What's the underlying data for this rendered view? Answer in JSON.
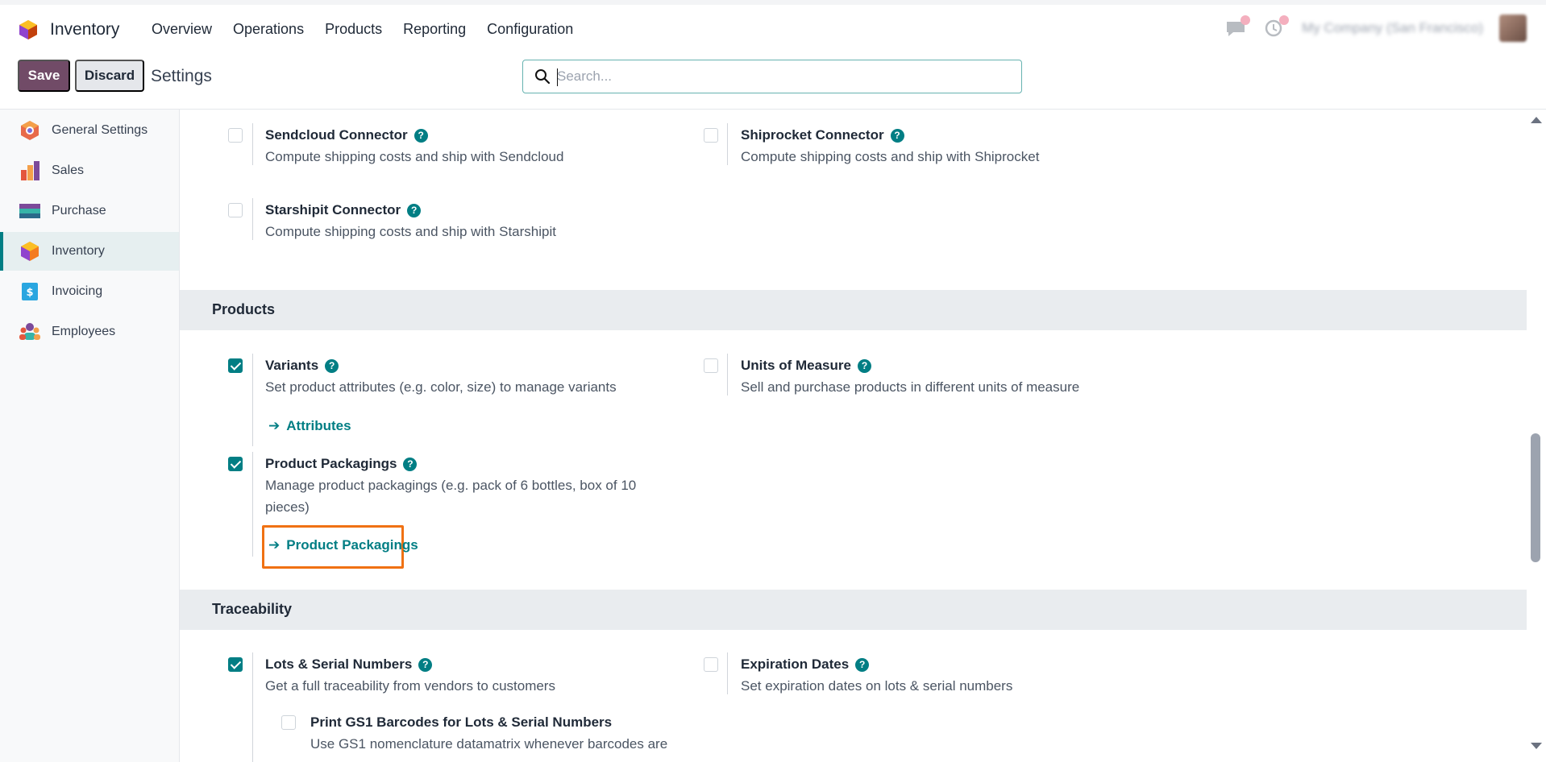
{
  "app": {
    "name": "Inventory"
  },
  "nav": {
    "items": [
      "Overview",
      "Operations",
      "Products",
      "Reporting",
      "Configuration"
    ]
  },
  "systray": {
    "company": "My Company (San Francisco)"
  },
  "control": {
    "save_label": "Save",
    "discard_label": "Discard",
    "title": "Settings",
    "search_placeholder": "Search..."
  },
  "sidebar": {
    "items": [
      {
        "label": "General Settings",
        "icon": "general-settings-icon"
      },
      {
        "label": "Sales",
        "icon": "sales-icon"
      },
      {
        "label": "Purchase",
        "icon": "purchase-icon"
      },
      {
        "label": "Inventory",
        "icon": "inventory-icon",
        "active": true
      },
      {
        "label": "Invoicing",
        "icon": "invoicing-icon"
      },
      {
        "label": "Employees",
        "icon": "employees-icon"
      }
    ]
  },
  "shipping": {
    "sendcloud": {
      "title": "Sendcloud Connector",
      "desc": "Compute shipping costs and ship with Sendcloud",
      "checked": false
    },
    "shiprocket": {
      "title": "Shiprocket Connector",
      "desc": "Compute shipping costs and ship with Shiprocket",
      "checked": false
    },
    "starshipit": {
      "title": "Starshipit Connector",
      "desc": "Compute shipping costs and ship with Starshipit",
      "checked": false
    }
  },
  "products": {
    "header": "Products",
    "variants": {
      "title": "Variants",
      "desc": "Set product attributes (e.g. color, size) to manage variants",
      "link": "Attributes",
      "checked": true
    },
    "uom": {
      "title": "Units of Measure",
      "desc": "Sell and purchase products in different units of measure",
      "checked": false
    },
    "packagings": {
      "title": "Product Packagings",
      "desc_line1": "Manage product packagings (e.g. pack of 6 bottles, box of 10",
      "desc_line2": "pieces)",
      "link": "Product Packagings",
      "checked": true
    }
  },
  "traceability": {
    "header": "Traceability",
    "lots": {
      "title": "Lots & Serial Numbers",
      "desc": "Get a full traceability from vendors to customers",
      "checked": true
    },
    "expiration": {
      "title": "Expiration Dates",
      "desc": "Set expiration dates on lots & serial numbers",
      "checked": false
    },
    "gs1": {
      "title": "Print GS1 Barcodes for Lots & Serial Numbers",
      "desc": "Use GS1 nomenclature datamatrix whenever barcodes are",
      "checked": false
    }
  },
  "colors": {
    "primary": "#714b67",
    "accent": "#017e84",
    "highlight": "#f07113"
  }
}
